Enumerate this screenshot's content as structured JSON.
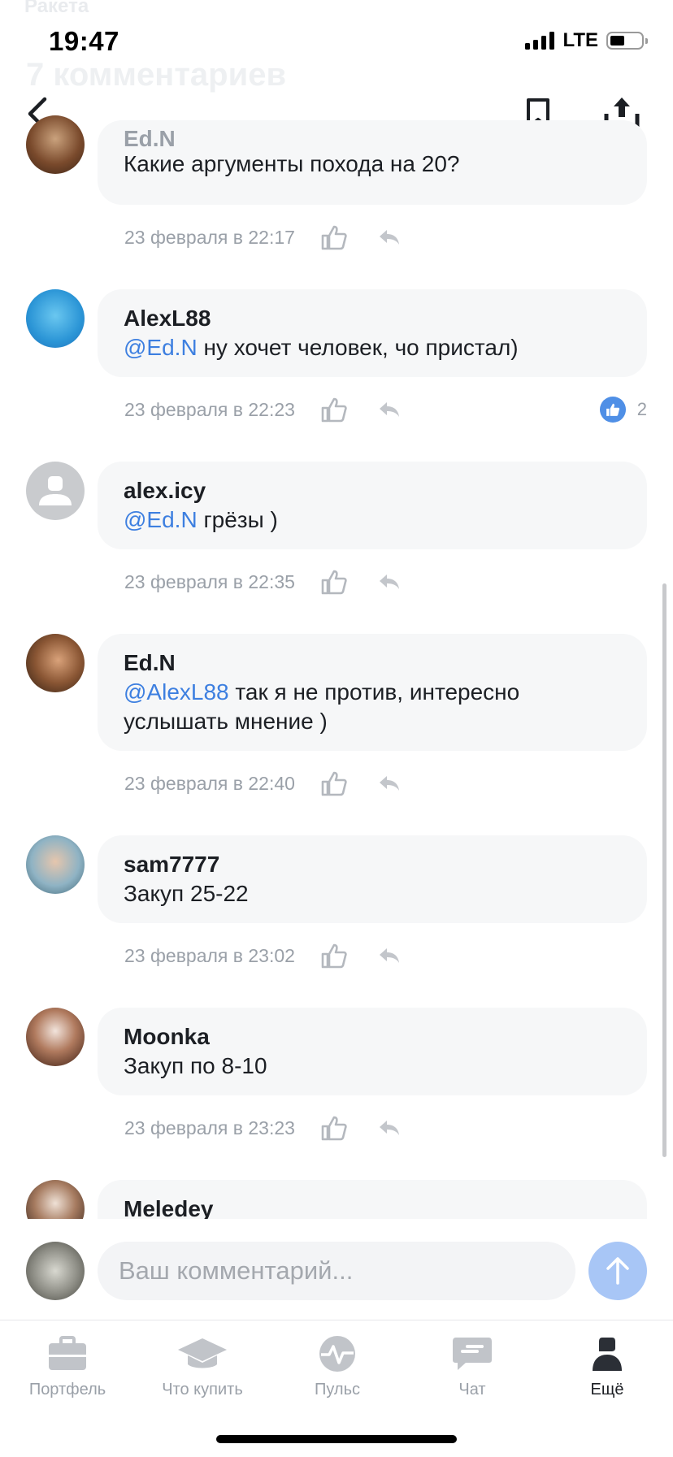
{
  "header": {
    "app_name": "Ракета",
    "page_title": "7 комментариев"
  },
  "status_bar": {
    "time": "19:47",
    "network": "LTE"
  },
  "comments": [
    {
      "author": "Ed.N",
      "text": "Какие аргументы похода на 20?",
      "mention": "",
      "time": "23 февраля в 22:17",
      "likes": ""
    },
    {
      "author": "AlexL88",
      "mention": "@Ed.N",
      "text": " ну хочет человек, чо пристал)",
      "time": "23 февраля в 22:23",
      "likes": "2"
    },
    {
      "author": "alex.icy",
      "mention": "@Ed.N",
      "text": " грёзы )",
      "time": "23 февраля в 22:35",
      "likes": ""
    },
    {
      "author": "Ed.N",
      "mention": "@AlexL88",
      "text": " так я не против, интересно услышать мнение )",
      "time": "23 февраля в 22:40",
      "likes": ""
    },
    {
      "author": "sam7777",
      "mention": "",
      "text": "Закуп 25-22",
      "time": "23 февраля в 23:02",
      "likes": ""
    },
    {
      "author": "Moonka",
      "mention": "",
      "text": "Закуп по 8-10",
      "time": "23 февраля в 23:23",
      "likes": ""
    },
    {
      "author": "Meledey",
      "mention": "",
      "text": "",
      "time": "",
      "likes": ""
    }
  ],
  "composer": {
    "placeholder": "Ваш комментарий..."
  },
  "tabbar": {
    "items": [
      {
        "label": "Портфель",
        "icon": "briefcase-icon"
      },
      {
        "label": "Что купить",
        "icon": "graduation-cap-icon"
      },
      {
        "label": "Пульс",
        "icon": "pulse-icon"
      },
      {
        "label": "Чат",
        "icon": "chat-icon"
      },
      {
        "label": "Ещё",
        "icon": "profile-icon"
      }
    ],
    "active": "Ещё"
  },
  "colors": {
    "accent": "#3d7fe0",
    "bubble": "#f6f7f8",
    "muted": "#9aa0a8",
    "send_button": "#a8c6f6"
  }
}
